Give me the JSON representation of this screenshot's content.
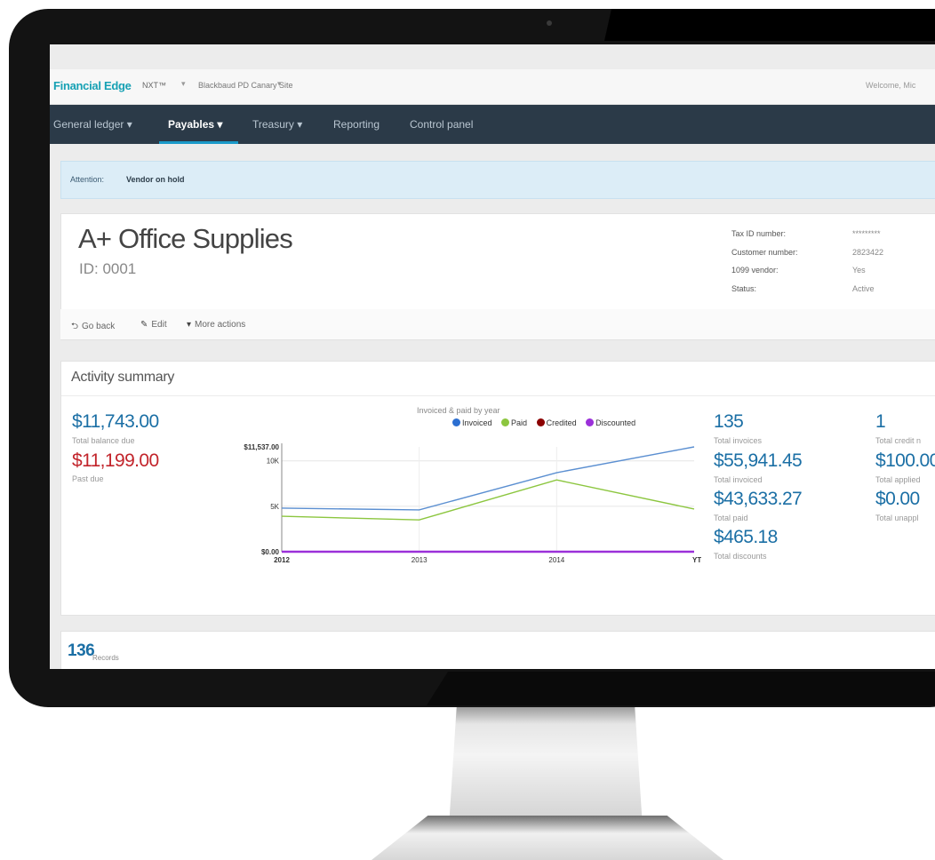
{
  "app": {
    "brand": "Financial Edge",
    "brand_suffix": "NXT™",
    "site": "Blackbaud PD Canary Site",
    "welcome": "Welcome, Mic"
  },
  "nav": {
    "items": [
      {
        "label": "General ledger ▾"
      },
      {
        "label": "Payables ▾"
      },
      {
        "label": "Treasury ▾"
      },
      {
        "label": "Reporting"
      },
      {
        "label": "Control panel"
      }
    ]
  },
  "alert": {
    "label": "Attention:",
    "message": "Vendor on hold"
  },
  "vendor": {
    "name": "A+ Office Supplies",
    "id": "ID: 0001",
    "details": [
      {
        "label": "Tax ID number:",
        "value": "*********"
      },
      {
        "label": "Customer number:",
        "value": "2823422"
      },
      {
        "label": "1099 vendor:",
        "value": "Yes"
      },
      {
        "label": "Status:",
        "value": "Active"
      }
    ]
  },
  "actions": {
    "go_back": "Go back",
    "edit": "Edit",
    "more": "More actions"
  },
  "summary": {
    "title": "Activity summary",
    "balance_due": "$11,743.00",
    "balance_due_label": "Total balance due",
    "past_due": "$11,199.00",
    "past_due_label": "Past due",
    "total_invoices": "135",
    "total_invoices_label": "Total invoices",
    "total_invoiced": "$55,941.45",
    "total_invoiced_label": "Total invoiced",
    "total_paid": "$43,633.27",
    "total_paid_label": "Total paid",
    "total_discounts": "$465.18",
    "total_discounts_label": "Total discounts",
    "total_credit": "1",
    "total_credit_label": "Total credit n",
    "total_applied": "$100.00",
    "total_applied_label": "Total applied",
    "total_unapplied": "$0.00",
    "total_unapplied_label": "Total unappl"
  },
  "records": {
    "count": "136",
    "label": "Records"
  },
  "colors": {
    "accent": "#1b6fa5",
    "danger": "#c2242b",
    "nav_bg": "#2b3a48",
    "brand": "#17a1b4"
  },
  "chart_data": {
    "type": "line",
    "title": "Invoiced & paid by year",
    "categories": [
      "2012",
      "2013",
      "2014",
      "YTD"
    ],
    "ytick_labels": [
      "$0.00",
      "5K",
      "10K",
      "$11,537.00"
    ],
    "ylim": [
      0,
      11537
    ],
    "series": [
      {
        "name": "Invoiced",
        "color": "#5b8fd1",
        "values": [
          4800,
          4600,
          8700,
          11537
        ]
      },
      {
        "name": "Paid",
        "color": "#8cc63f",
        "values": [
          3900,
          3500,
          7900,
          4700
        ]
      },
      {
        "name": "Credited",
        "color": "#8b0000",
        "values": [
          0,
          0,
          0,
          0
        ]
      },
      {
        "name": "Discounted",
        "color": "#9b30d9",
        "values": [
          0,
          0,
          0,
          0
        ]
      }
    ],
    "legend": "top-right"
  }
}
